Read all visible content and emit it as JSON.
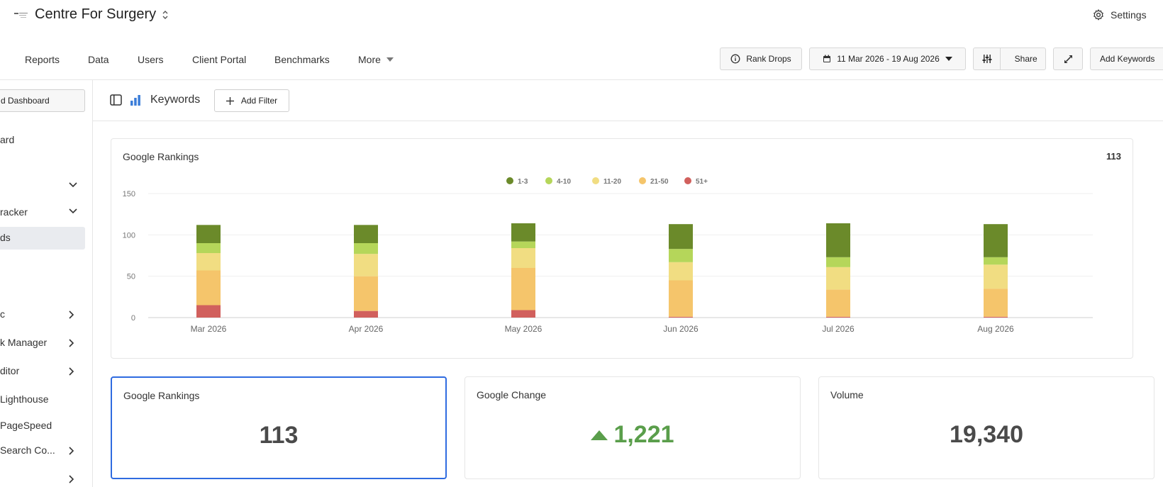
{
  "app": {
    "title": "Centre For Surgery",
    "settings_label": "Settings"
  },
  "nav": {
    "items": [
      {
        "label": "Reports"
      },
      {
        "label": "Data"
      },
      {
        "label": "Users"
      },
      {
        "label": "Client Portal"
      },
      {
        "label": "Benchmarks"
      },
      {
        "label": "More"
      }
    ]
  },
  "toolbar": {
    "rank_drops_label": "Rank Drops",
    "date_range": "11 Mar 2026 - 19 Aug 2026",
    "share_label": "Share",
    "add_keywords_label": "Add Keywords"
  },
  "sidebar": {
    "dashboard_button": "d Dashboard",
    "items": [
      {
        "label": "ard"
      },
      {
        "label": ""
      },
      {
        "label": "racker"
      },
      {
        "label": "ds"
      },
      {
        "label": "c"
      },
      {
        "label": "k Manager"
      },
      {
        "label": "ditor"
      },
      {
        "label": " Lighthouse"
      },
      {
        "label": " PageSpeed"
      },
      {
        "label": " Search Co..."
      },
      {
        "label": ""
      }
    ]
  },
  "subheader": {
    "title": "Keywords",
    "add_filter_label": "Add Filter"
  },
  "chart_card": {
    "title": "Google Rankings",
    "total": "113"
  },
  "chart_data": {
    "type": "bar",
    "stacked": true,
    "categories": [
      "Mar 2026",
      "Apr 2026",
      "May 2026",
      "Jun 2026",
      "Jul 2026",
      "Aug 2026"
    ],
    "series": [
      {
        "name": "51+",
        "color": "#d1605d",
        "values": [
          15,
          8,
          9,
          1,
          1,
          1
        ]
      },
      {
        "name": "21-50",
        "color": "#f5c56b",
        "values": [
          42,
          42,
          51,
          44,
          33,
          34
        ]
      },
      {
        "name": "11-20",
        "color": "#f1dd82",
        "values": [
          21,
          27,
          24,
          22,
          27,
          29
        ]
      },
      {
        "name": "4-10",
        "color": "#b5d65a",
        "values": [
          12,
          13,
          8,
          16,
          12,
          9
        ]
      },
      {
        "name": "1-3",
        "color": "#6b8a2a",
        "values": [
          22,
          22,
          22,
          30,
          41,
          40
        ]
      }
    ],
    "legend_order": [
      "1-3",
      "4-10",
      "11-20",
      "21-50",
      "51+"
    ],
    "y_ticks": [
      0,
      50,
      100,
      150
    ],
    "ylim": [
      0,
      150
    ],
    "grid": true,
    "legend_position": "top-center"
  },
  "stats": [
    {
      "title": "Google Rankings",
      "value": "113"
    },
    {
      "title": "Google Change",
      "value": "1,221"
    },
    {
      "title": "Volume",
      "value": "19,340"
    }
  ],
  "colors": {
    "accent": "#2f6be0",
    "positive": "#5a9e4b",
    "chart_icon": "#3b7dd8"
  }
}
